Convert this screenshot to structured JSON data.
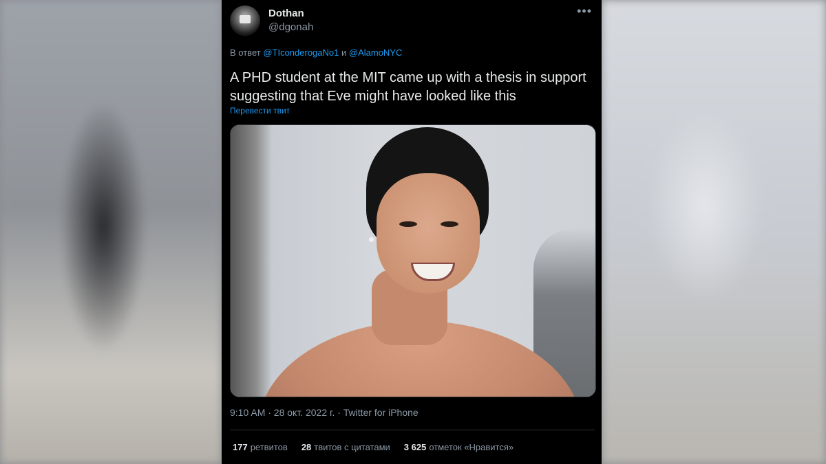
{
  "tweet": {
    "author_name": "Dothan",
    "author_handle": "@dgonah",
    "reply_prefix": "В ответ",
    "reply_to_1": "@TIconderogaNo1",
    "reply_joiner": "и",
    "reply_to_2": "@AlamoNYC",
    "text": "A PHD student at the MIT came up with a thesis in support suggesting that Eve might have looked like this",
    "translate_label": "Перевести твит",
    "more_icon": "•••",
    "meta": "9:10 AM · 28 окт. 2022 г. · Twitter for iPhone"
  },
  "stats": {
    "retweets_count": "177",
    "retweets_label": "ретвитов",
    "quotes_count": "28",
    "quotes_label": "твитов с цитатами",
    "likes_count": "3 625",
    "likes_label": "отметок «Нравится»"
  },
  "colors": {
    "background": "#000000",
    "text": "#e7e9ea",
    "muted": "#8b98a5",
    "link": "#1d9bf0"
  }
}
